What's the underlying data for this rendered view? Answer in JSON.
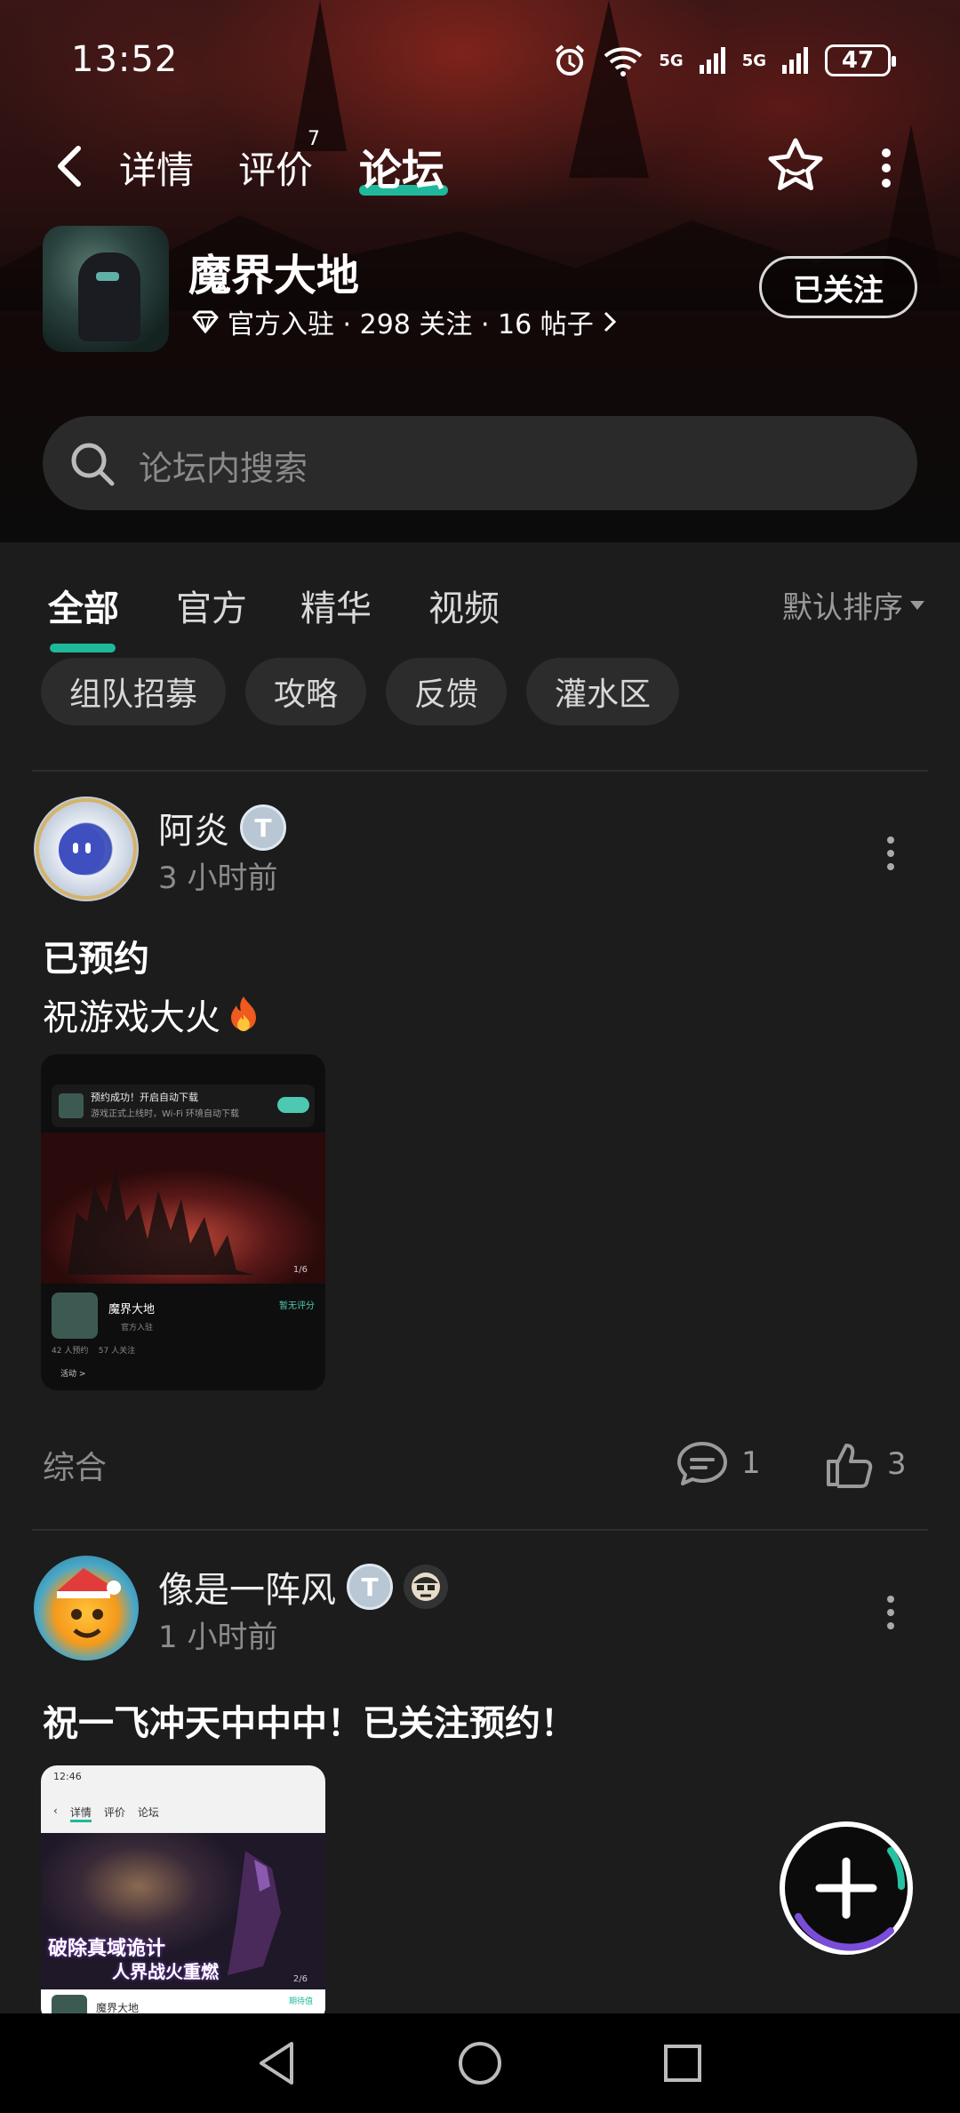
{
  "status_bar": {
    "time": "13:52",
    "net1": "5G",
    "net2": "5G",
    "battery": "47"
  },
  "nav": {
    "tabs": [
      {
        "label": "详情"
      },
      {
        "label": "评价",
        "badge": "7"
      },
      {
        "label": "论坛",
        "active": true
      }
    ]
  },
  "app": {
    "name": "魔界大地",
    "meta": "官方入驻 · 298 关注 · 16 帖子",
    "follow_button": "已关注"
  },
  "search": {
    "placeholder": "论坛内搜索"
  },
  "forum_tabs": [
    "全部",
    "官方",
    "精华",
    "视频"
  ],
  "sort_label": "默认排序",
  "chips": [
    "组队招募",
    "攻略",
    "反馈",
    "灌水区"
  ],
  "posts": [
    {
      "user": "阿炎",
      "time": "3 小时前",
      "title": "已预约",
      "body": "祝游戏大火",
      "screenshot": {
        "toast_title": "预约成功！开启自动下载",
        "toast_sub": "游戏正式上线时，Wi-Fi 环境自动下载",
        "counter": "1/6",
        "app_name": "魔界大地",
        "rating": "暂无评分",
        "official": "官方入驻",
        "stats": "42 人预约    57 人关注",
        "activity": "活动 >"
      },
      "tag": "综合",
      "comments": "1",
      "likes": "3"
    },
    {
      "user": "像是一阵风",
      "time": "1 小时前",
      "title": "祝一飞冲天中中中！已关注预约！",
      "screenshot": {
        "time": "12:46",
        "tabs": [
          "详情",
          "评价",
          "论坛"
        ],
        "banner1": "破除真域诡计",
        "banner2": "人界战火重燃",
        "counter": "2/6",
        "app_name": "魔界大地",
        "rating": "期待值"
      }
    }
  ],
  "colors": {
    "accent": "#1fb89a",
    "background": "#1c1c1c"
  }
}
